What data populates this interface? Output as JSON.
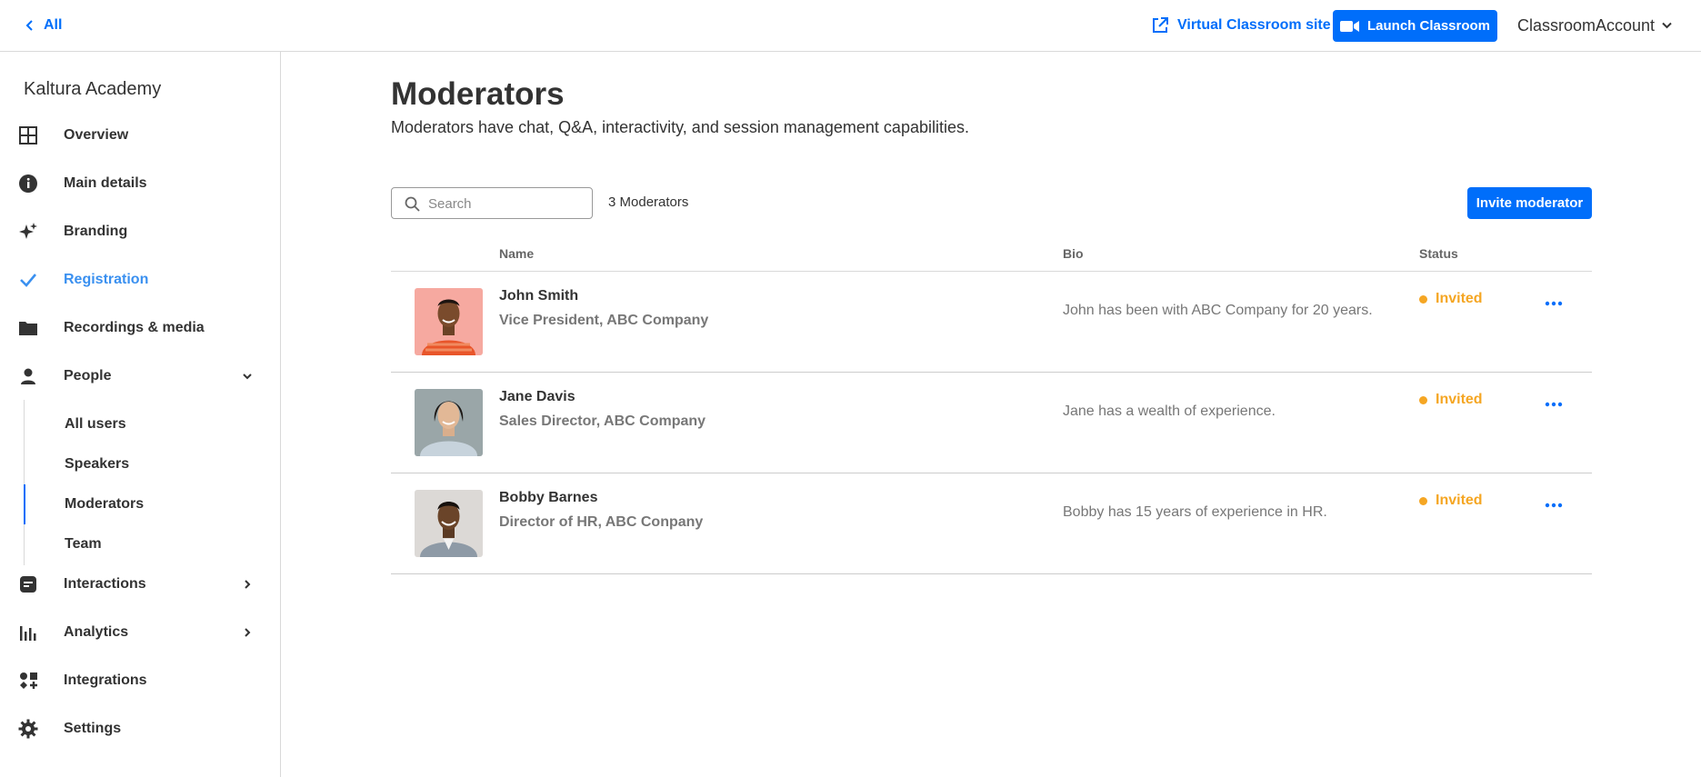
{
  "topbar": {
    "back_label": "All",
    "virtual_classroom_label": "Virtual Classroom site",
    "launch_label": "Launch Classroom",
    "account_label": "ClassroomAccount"
  },
  "sidebar": {
    "org_name": "Kaltura Academy",
    "items": [
      {
        "label": "Overview",
        "icon": "grid-icon"
      },
      {
        "label": "Main details",
        "icon": "info-icon"
      },
      {
        "label": "Branding",
        "icon": "sparkles-icon"
      },
      {
        "label": "Registration",
        "icon": "checkmark-icon",
        "active": true
      },
      {
        "label": "Recordings & media",
        "icon": "folder-icon"
      },
      {
        "label": "People",
        "icon": "person-icon",
        "expanded": true
      },
      {
        "label": "Interactions",
        "icon": "chat-icon"
      },
      {
        "label": "Analytics",
        "icon": "bar-chart-icon"
      },
      {
        "label": "Integrations",
        "icon": "integrations-icon"
      },
      {
        "label": "Settings",
        "icon": "gear-icon"
      }
    ],
    "people_subitems": [
      {
        "label": "All users"
      },
      {
        "label": "Speakers"
      },
      {
        "label": "Moderators",
        "active": true
      },
      {
        "label": "Team"
      }
    ]
  },
  "main": {
    "title": "Moderators",
    "description": "Moderators have chat, Q&A, interactivity, and session management capabilities.",
    "search_placeholder": "Search",
    "count_label": "3 Moderators",
    "invite_label": "Invite moderator",
    "columns": {
      "name": "Name",
      "bio": "Bio",
      "status": "Status"
    },
    "rows": [
      {
        "name": "John Smith",
        "title": "Vice President, ABC Company",
        "bio": "John has been with ABC Company for 20 years.",
        "status": "Invited"
      },
      {
        "name": "Jane Davis",
        "title": "Sales Director, ABC Company",
        "bio": "Jane has a wealth of experience.",
        "status": "Invited"
      },
      {
        "name": "Bobby Barnes",
        "title": "Director of HR, ABC Conpany",
        "bio": "Bobby has 15 years of experience in HR.",
        "status": "Invited"
      }
    ]
  },
  "colors": {
    "accent": "#006efa",
    "active_nav": "#3a90f0",
    "status_invited": "#f5a623"
  }
}
